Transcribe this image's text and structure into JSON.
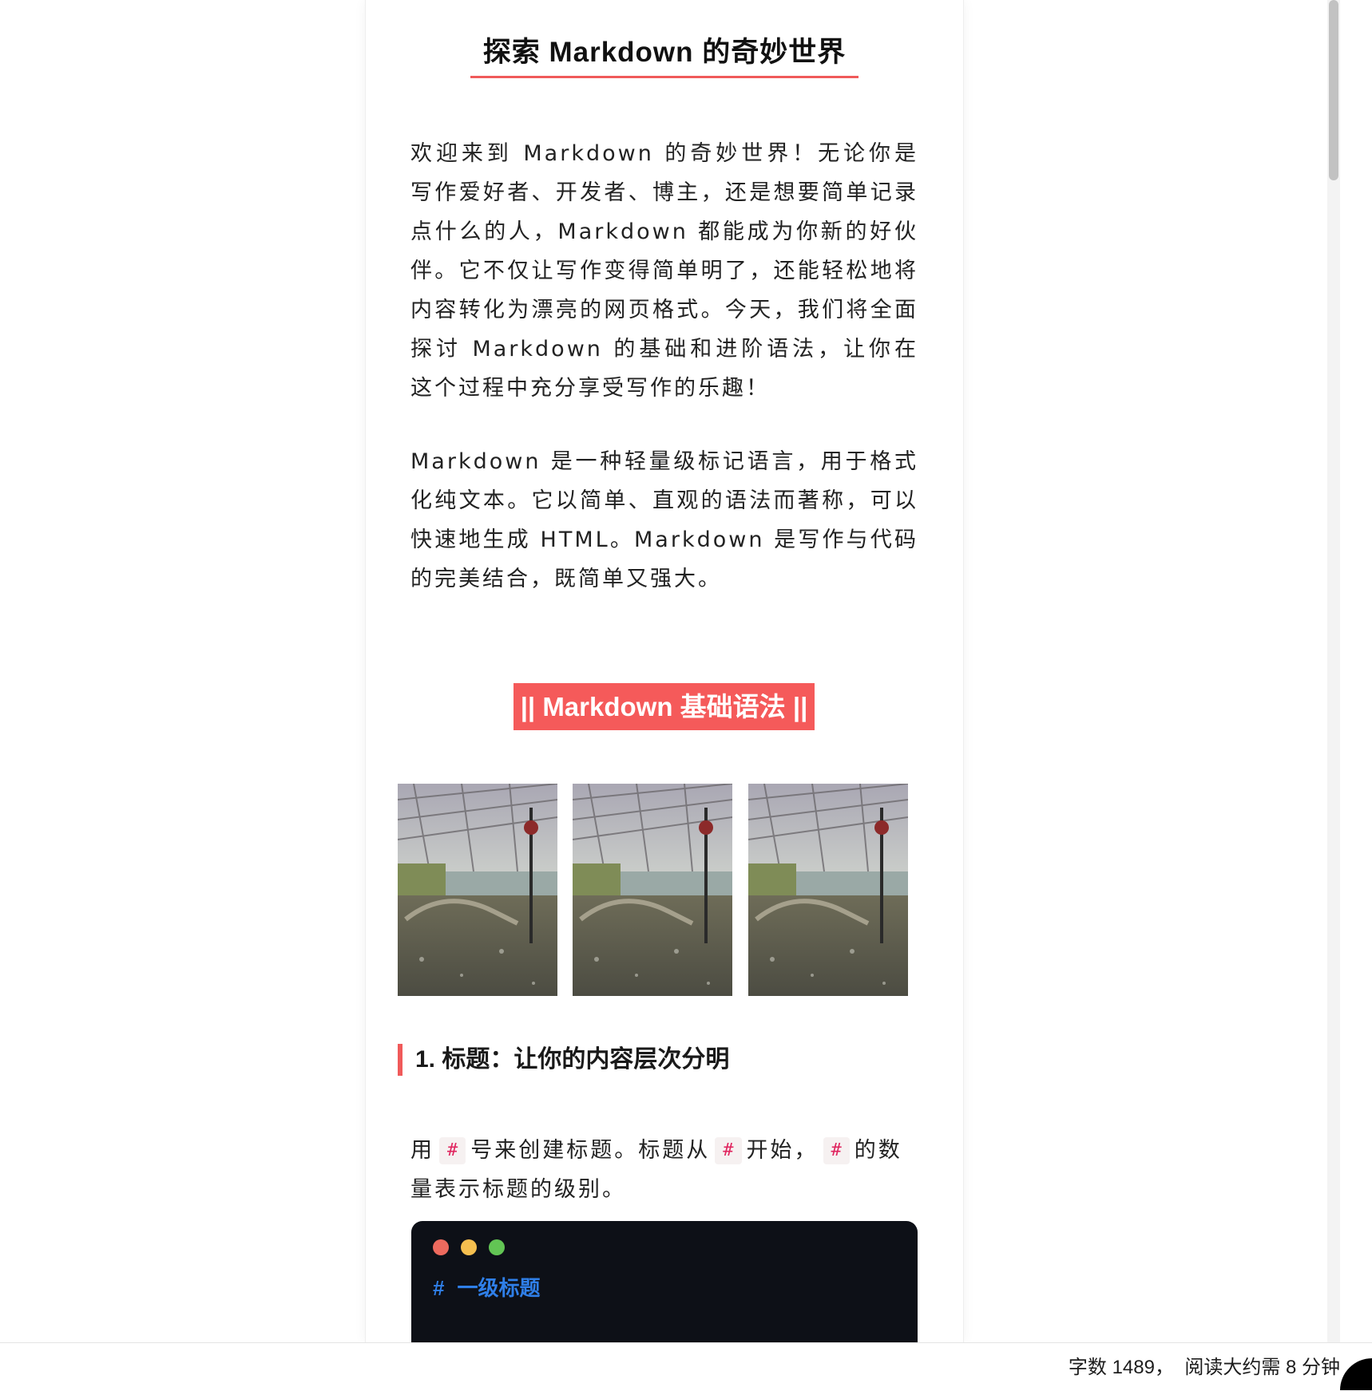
{
  "article": {
    "title": "探索 Markdown 的奇妙世界",
    "intro_paragraph": "欢迎来到 Markdown 的奇妙世界！无论你是写作爱好者、开发者、博主，还是想要简单记录点什么的人，Markdown 都能成为你新的好伙伴。它不仅让写作变得简单明了，还能轻松地将内容转化为漂亮的网页格式。今天，我们将全面探讨 Markdown 的基础和进阶语法，让你在这个过程中充分享受写作的乐趣！",
    "definition_paragraph": "Markdown 是一种轻量级标记语言，用于格式化纯文本。它以简单、直观的语法而著称，可以快速地生成 HTML。Markdown 是写作与代码的完美结合，既简单又强大。",
    "section_badge": "|| Markdown 基础语法 ||",
    "gallery": {
      "image_count": 3,
      "image_subject": "greenhouse-pond-photo"
    },
    "subheading": "1. 标题：让你的内容层次分明",
    "heading_paragraph": {
      "part1": "用",
      "code1": "#",
      "part2": "号来创建标题。标题从",
      "code2": "#",
      "part3": "开始，",
      "code3": "#",
      "part4": "的数量表示标题的级别。"
    },
    "code_block": {
      "hash": "#",
      "text": "一级标题"
    }
  },
  "status_bar": {
    "text": "字数 1489，  阅读大约需 8 分钟"
  },
  "colors": {
    "accent": "#f05a5a",
    "badge_bg": "#f55a5a",
    "code_bg": "#0d1017",
    "code_heading": "#2f7fe8",
    "inline_code": "#e0245e",
    "window_red": "#ed6a5e",
    "window_yellow": "#f5bf4f",
    "window_green": "#62c554"
  }
}
